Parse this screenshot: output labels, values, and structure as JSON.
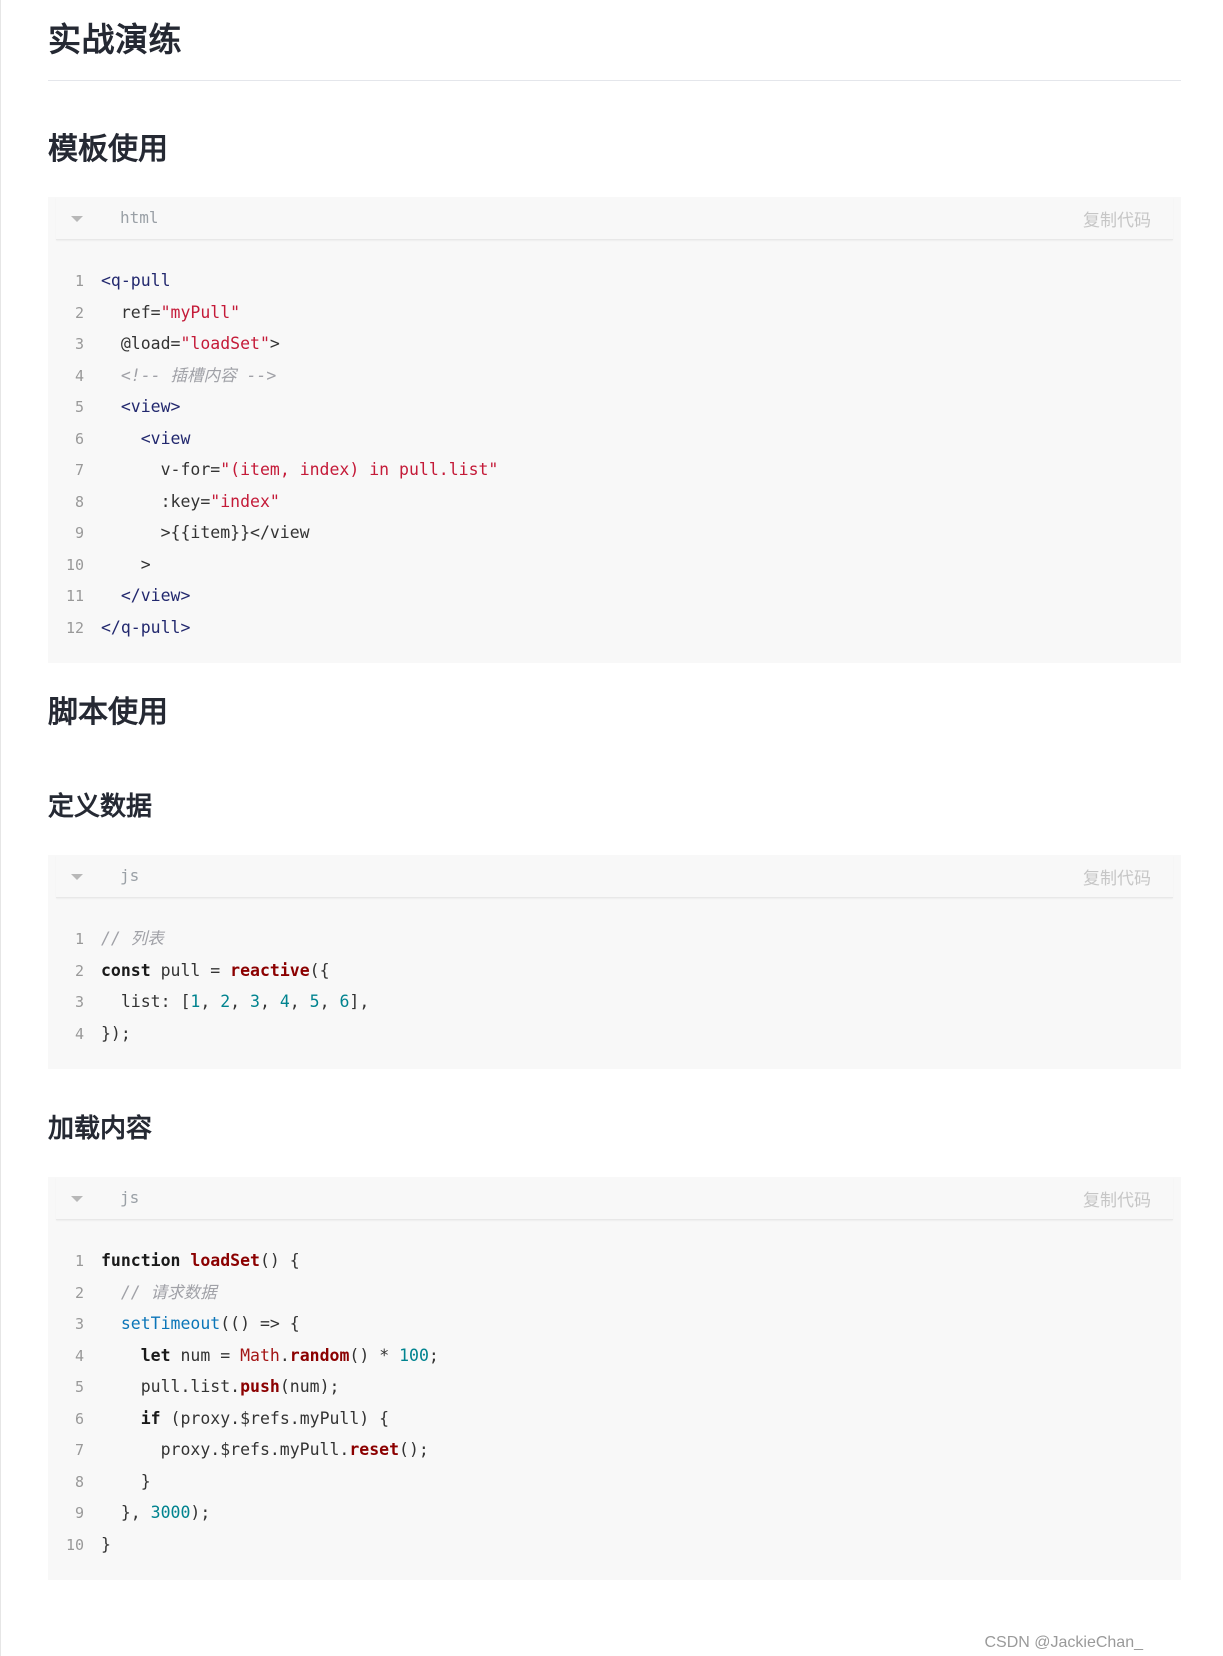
{
  "title": "实战演练",
  "sections": {
    "template_usage": "模板使用",
    "script_usage": "脚本使用",
    "define_data": "定义数据",
    "load_content": "加载内容"
  },
  "code_blocks": [
    {
      "lang": "html",
      "copy_label": "复制代码",
      "line_numbers": [
        "1",
        "2",
        "3",
        "4",
        "5",
        "6",
        "7",
        "8",
        "9",
        "10",
        "11",
        "12"
      ],
      "lines": [
        [
          {
            "t": "tag",
            "v": "<q-pull"
          }
        ],
        [
          {
            "t": "pl",
            "v": "  ref="
          },
          {
            "t": "str",
            "v": "\"myPull\""
          }
        ],
        [
          {
            "t": "pl",
            "v": "  @load="
          },
          {
            "t": "str",
            "v": "\"loadSet\""
          },
          {
            "t": "pl",
            "v": ">"
          }
        ],
        [
          {
            "t": "com",
            "v": "  <!-- 插槽内容 -->"
          }
        ],
        [
          {
            "t": "tag",
            "v": "  <view>"
          }
        ],
        [
          {
            "t": "tag",
            "v": "    <view"
          }
        ],
        [
          {
            "t": "pl",
            "v": "      v-for="
          },
          {
            "t": "str",
            "v": "\"(item, index) in pull.list\""
          }
        ],
        [
          {
            "t": "pl",
            "v": "      :key="
          },
          {
            "t": "str",
            "v": "\"index\""
          }
        ],
        [
          {
            "t": "pl",
            "v": "      >{{item}}</view"
          }
        ],
        [
          {
            "t": "pl",
            "v": "    >"
          }
        ],
        [
          {
            "t": "tag",
            "v": "  </view>"
          }
        ],
        [
          {
            "t": "tag",
            "v": "</q-pull>"
          }
        ]
      ]
    },
    {
      "lang": "js",
      "copy_label": "复制代码",
      "line_numbers": [
        "1",
        "2",
        "3",
        "4"
      ],
      "lines": [
        [
          {
            "t": "com",
            "v": "// 列表"
          }
        ],
        [
          {
            "t": "kw",
            "v": "const"
          },
          {
            "t": "pl",
            "v": " pull = "
          },
          {
            "t": "fn",
            "v": "reactive"
          },
          {
            "t": "pl",
            "v": "({"
          }
        ],
        [
          {
            "t": "pl",
            "v": "  list: ["
          },
          {
            "t": "num",
            "v": "1"
          },
          {
            "t": "pl",
            "v": ", "
          },
          {
            "t": "num",
            "v": "2"
          },
          {
            "t": "pl",
            "v": ", "
          },
          {
            "t": "num",
            "v": "3"
          },
          {
            "t": "pl",
            "v": ", "
          },
          {
            "t": "num",
            "v": "4"
          },
          {
            "t": "pl",
            "v": ", "
          },
          {
            "t": "num",
            "v": "5"
          },
          {
            "t": "pl",
            "v": ", "
          },
          {
            "t": "num",
            "v": "6"
          },
          {
            "t": "pl",
            "v": "],"
          }
        ],
        [
          {
            "t": "pl",
            "v": "});"
          }
        ]
      ]
    },
    {
      "lang": "js",
      "copy_label": "复制代码",
      "line_numbers": [
        "1",
        "2",
        "3",
        "4",
        "5",
        "6",
        "7",
        "8",
        "9",
        "10"
      ],
      "lines": [
        [
          {
            "t": "kw",
            "v": "function"
          },
          {
            "t": "pl",
            "v": " "
          },
          {
            "t": "fn",
            "v": "loadSet"
          },
          {
            "t": "pl",
            "v": "() {"
          }
        ],
        [
          {
            "t": "com",
            "v": "  // 请求数据"
          }
        ],
        [
          {
            "t": "pl",
            "v": "  "
          },
          {
            "t": "bi",
            "v": "setTimeout"
          },
          {
            "t": "pl",
            "v": "(() => {"
          }
        ],
        [
          {
            "t": "pl",
            "v": "    "
          },
          {
            "t": "kw",
            "v": "let"
          },
          {
            "t": "pl",
            "v": " num = "
          },
          {
            "t": "obj",
            "v": "Math"
          },
          {
            "t": "pl",
            "v": "."
          },
          {
            "t": "fn",
            "v": "random"
          },
          {
            "t": "pl",
            "v": "() * "
          },
          {
            "t": "num",
            "v": "100"
          },
          {
            "t": "pl",
            "v": ";"
          }
        ],
        [
          {
            "t": "pl",
            "v": "    pull.list."
          },
          {
            "t": "fn",
            "v": "push"
          },
          {
            "t": "pl",
            "v": "(num);"
          }
        ],
        [
          {
            "t": "pl",
            "v": "    "
          },
          {
            "t": "kw",
            "v": "if"
          },
          {
            "t": "pl",
            "v": " (proxy.$refs.myPull) {"
          }
        ],
        [
          {
            "t": "pl",
            "v": "      proxy.$refs.myPull."
          },
          {
            "t": "fn",
            "v": "reset"
          },
          {
            "t": "pl",
            "v": "();"
          }
        ],
        [
          {
            "t": "pl",
            "v": "    }"
          }
        ],
        [
          {
            "t": "pl",
            "v": "  }, "
          },
          {
            "t": "num",
            "v": "3000"
          },
          {
            "t": "pl",
            "v": ");"
          }
        ],
        [
          {
            "t": "pl",
            "v": "}"
          }
        ]
      ]
    }
  ],
  "watermark": "CSDN @JackieChan_"
}
